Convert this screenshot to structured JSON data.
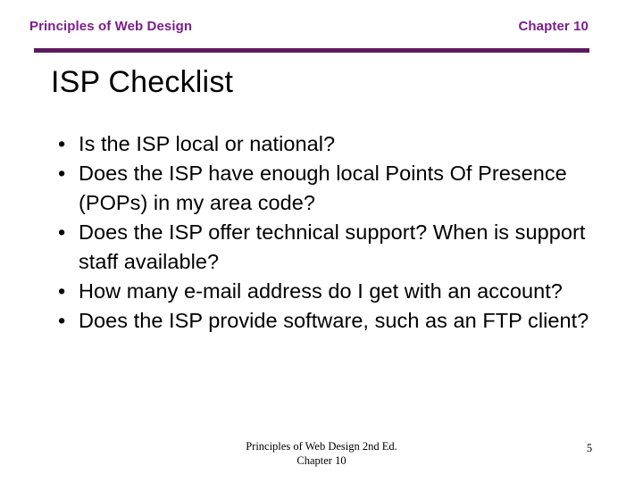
{
  "slide": {
    "header": {
      "left_text": "Principles of Web Design",
      "right_text": "Chapter 10",
      "accent_color": "#7c1d8c",
      "rule_color": "#5d1a5d"
    },
    "title": "ISP Checklist",
    "bullet_marker": "•",
    "bullets": [
      "Is the ISP local or national?",
      "Does the ISP have enough local Points Of Presence (POPs) in my area code?",
      "Does the ISP offer technical support? When is support staff available?",
      "How many e-mail address do I get with an account?",
      "Does the ISP provide software, such as an FTP client?"
    ],
    "footer": {
      "line1": "Principles of Web Design 2nd Ed.",
      "line2": "Chapter 10",
      "page_number": "5"
    }
  }
}
